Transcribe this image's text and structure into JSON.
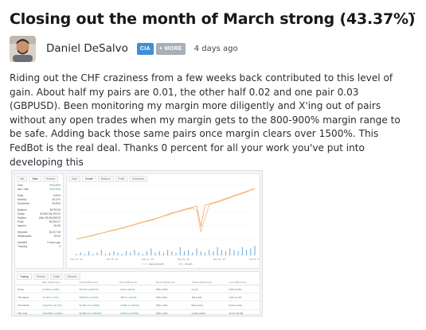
{
  "post": {
    "title": "Closing out the month of March strong (43.37%)",
    "menu_label": "···",
    "author": "Daniel DeSalvo",
    "badges": [
      "CIA",
      "+ MORE"
    ],
    "time": "4 days ago",
    "body": "Riding out the CHF craziness from a few weeks back contributed to this level of gain. About half my pairs are 0.01, the other half 0.02 and one pair 0.03 (GBPUSD). Been monitoring my margin more diligently and X'ing out of pairs without any open trades when my margin gets to the 800-900% margin range to be safe. Adding back those same pairs once margin clears over 1500%. This FedBot is the real deal. Thanks 0 percent for all your work you've put into developing this"
  },
  "screenshot": {
    "left_tabs": [
      "Info",
      "Stats",
      "General"
    ],
    "stats": [
      {
        "label": "Gain",
        "value": "+944.00%"
      },
      {
        "label": "Abs. Gain",
        "value": "+432.00%"
      },
      {
        "label": "Daily",
        "value": "0.81%"
      },
      {
        "label": "Monthly",
        "value": "28.12%"
      },
      {
        "label": "Drawdown",
        "value": "36.05%"
      },
      {
        "label": "Balance",
        "value": "$4750.09"
      },
      {
        "label": "Equity",
        "value": "84.38% $4,090.92"
      },
      {
        "label": "Highest",
        "value": "(Mar 25) $4,865.99"
      },
      {
        "label": "Profit",
        "value": "$3,250.07"
      },
      {
        "label": "Interest",
        "value": "-$1.89"
      },
      {
        "label": "Deposits",
        "value": "$1,517.60"
      },
      {
        "label": "Withdrawals",
        "value": "$0.00"
      },
      {
        "label": "Updated",
        "value": "3 hours ago"
      },
      {
        "label": "Tracking",
        "value": "0"
      }
    ],
    "chart_tabs": [
      "Gain",
      "Growth",
      "Balance",
      "Profit",
      "Drawdown"
    ],
    "chart_legend": [
      "Equity Growth",
      "Growth"
    ],
    "x_ticks": [
      "Dec 15, '14",
      "Jan 15, '15",
      "Feb 17, '15",
      "Mar 01, '15",
      "Mar 19, '15",
      "Apr 01, '15"
    ],
    "table_tabs": [
      "Trading",
      "Periods",
      "Goals",
      "Browser"
    ],
    "table_headers": [
      "",
      "Gain (Difference)",
      "Profit (Difference)",
      "Pips (Difference)",
      "Win% (Difference)",
      "Trades (Difference)",
      "Lots (Difference)"
    ],
    "table_rows": [
      [
        "Today",
        "+4.93% (+3.9%)",
        "$27.80 (+39.97%)",
        "+111.9 (+84.2)",
        "75% (+5%)",
        "4 (+2)",
        "0.02 (+0.01)"
      ],
      [
        "This Week",
        "+9.72% (-2.1%)",
        "$293.51 (+19.4%)",
        "+563.3 (+122.4)",
        "73% (-2%)",
        "118 (+15)",
        "1.20 (+0.17)"
      ],
      [
        "This Month",
        "+43.37% (+37.1%)",
        "$1,351.70 (+150%)",
        "+2,505.4 (+18.5%)",
        "75% (+4%)",
        "532 (+217)",
        "5.31 (+2.04)"
      ],
      [
        "This Year",
        "+164.58% (+110%)",
        "$2,800.44 (+198.4%)",
        "+6,057.0 (+215%)",
        "74% (+1%)",
        "1,213 (+512)",
        "12.74 (+5.18)"
      ]
    ],
    "chart_data": {
      "type": "line",
      "series": [
        {
          "name": "Growth",
          "values": [
            0,
            8,
            12,
            18,
            22,
            30,
            34,
            40,
            47,
            52,
            58,
            63,
            70,
            76,
            83,
            90,
            96,
            103,
            108,
            115,
            122,
            130,
            138,
            146,
            152,
            158,
            166,
            172,
            178,
            185,
            70,
            190,
            196,
            204,
            210,
            218,
            226,
            234,
            243,
            250,
            258,
            266,
            275,
            283
          ]
        },
        {
          "name": "Equity Growth",
          "values": [
            0,
            6,
            10,
            16,
            20,
            28,
            33,
            38,
            45,
            50,
            56,
            60,
            68,
            74,
            80,
            88,
            94,
            100,
            104,
            112,
            120,
            128,
            134,
            142,
            150,
            155,
            162,
            168,
            174,
            160,
            40,
            120,
            190,
            200,
            206,
            214,
            222,
            230,
            240,
            246,
            254,
            262,
            272,
            280
          ]
        }
      ],
      "bars": [
        1,
        2,
        1,
        3,
        1,
        2,
        4,
        1,
        2,
        3,
        2,
        1,
        3,
        2,
        4,
        2,
        1,
        3,
        5,
        2,
        3,
        2,
        4,
        3,
        2,
        6,
        3,
        4,
        2,
        5,
        3,
        2,
        4,
        3,
        6,
        4,
        3,
        5,
        4,
        3,
        6,
        4,
        5,
        7
      ]
    }
  }
}
